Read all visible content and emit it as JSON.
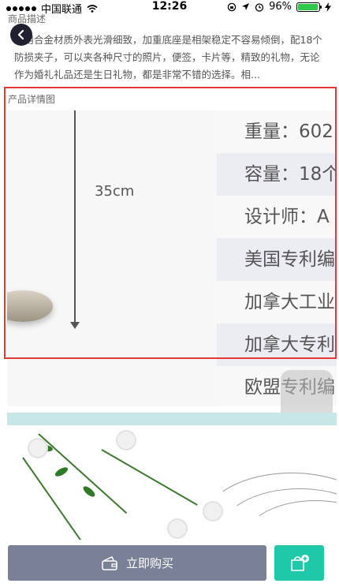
{
  "status_bar": {
    "carrier": "中国联通",
    "time": "12:26",
    "battery": "96%",
    "battery_level": 0.96
  },
  "description": {
    "title": "商品描述",
    "text": "采用合金材质外表光滑细致，加重底座是相架稳定不容易倾倒，配18个防损夹子，可以夹各种尺寸的照片，便签，卡片等，精致的礼物，无论作为婚礼礼品还是生日礼物，都是非常不错的选择。相..."
  },
  "detail": {
    "title": "产品详情图",
    "measure_label": "35cm",
    "specs": [
      "重量：602",
      "容量：18个",
      "设计师：A",
      "美国专利编",
      "加拿大工业",
      "加拿大专利",
      "欧盟专利编"
    ]
  },
  "bottom_bar": {
    "buy_label": "立即购买"
  },
  "icons": {
    "back": "chevron-left-icon",
    "buy": "wallet-icon",
    "cart": "add-cart-icon"
  },
  "colors": {
    "buy_button": "#7a8096",
    "cart_button": "#1fc9a8",
    "highlight": "#e53935"
  }
}
